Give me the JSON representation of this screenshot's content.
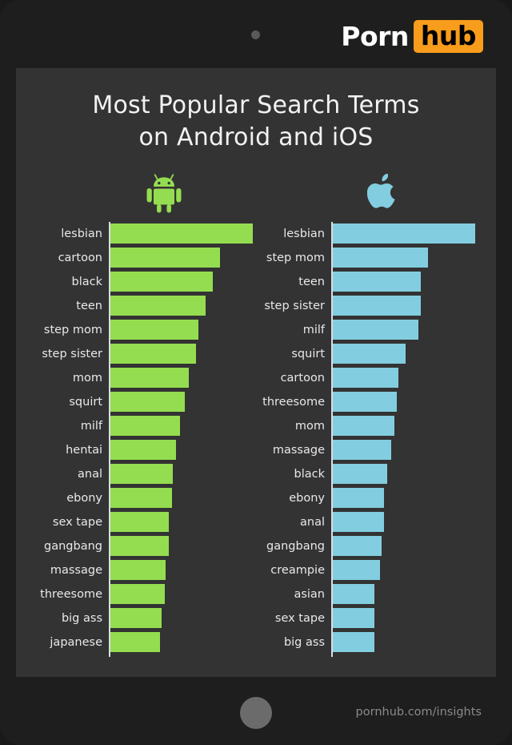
{
  "brand": {
    "name_part1": "Porn",
    "name_part2": "hub",
    "accent_color": "#f89c1c"
  },
  "header": {
    "title_line1": "Most Popular Search Terms",
    "title_line2": "on Android and iOS"
  },
  "platforms": [
    {
      "key": "android",
      "icon": "android-robot-icon",
      "color": "#94dd50",
      "label": "Android"
    },
    {
      "key": "ios",
      "icon": "apple-logo-icon",
      "color": "#82cddf",
      "label": "iOS"
    }
  ],
  "footer": {
    "url": "pornhub.com/insights",
    "home_button": "home-button"
  },
  "chart_data": {
    "type": "bar",
    "orientation": "horizontal",
    "title": "Most Popular Search Terms on Android and iOS",
    "xlabel": "",
    "ylabel": "",
    "grid": false,
    "legend": "icons above each column",
    "panels": [
      {
        "name": "Android",
        "icon": "android-robot-icon",
        "color": "#94dd50",
        "categories": [
          "lesbian",
          "cartoon",
          "black",
          "teen",
          "step mom",
          "step sister",
          "mom",
          "squirt",
          "milf",
          "hentai",
          "anal",
          "ebony",
          "sex tape",
          "gangbang",
          "massage",
          "threesome",
          "big ass",
          "japanese"
        ],
        "values": [
          100,
          77,
          72,
          67,
          62,
          60,
          55,
          52,
          49,
          46,
          44,
          43,
          41,
          41,
          39,
          38,
          36,
          35
        ],
        "xlim": [
          0,
          100
        ]
      },
      {
        "name": "iOS",
        "icon": "apple-logo-icon",
        "color": "#82cddf",
        "categories": [
          "lesbian",
          "step mom",
          "teen",
          "step sister",
          "milf",
          "squirt",
          "cartoon",
          "threesome",
          "mom",
          "massage",
          "black",
          "ebony",
          "anal",
          "gangbang",
          "creampie",
          "asian",
          "sex tape",
          "big ass"
        ],
        "values": [
          100,
          67,
          62,
          62,
          60,
          51,
          46,
          45,
          43,
          41,
          38,
          36,
          36,
          34,
          33,
          29,
          29,
          29
        ],
        "xlim": [
          0,
          100
        ]
      }
    ]
  }
}
